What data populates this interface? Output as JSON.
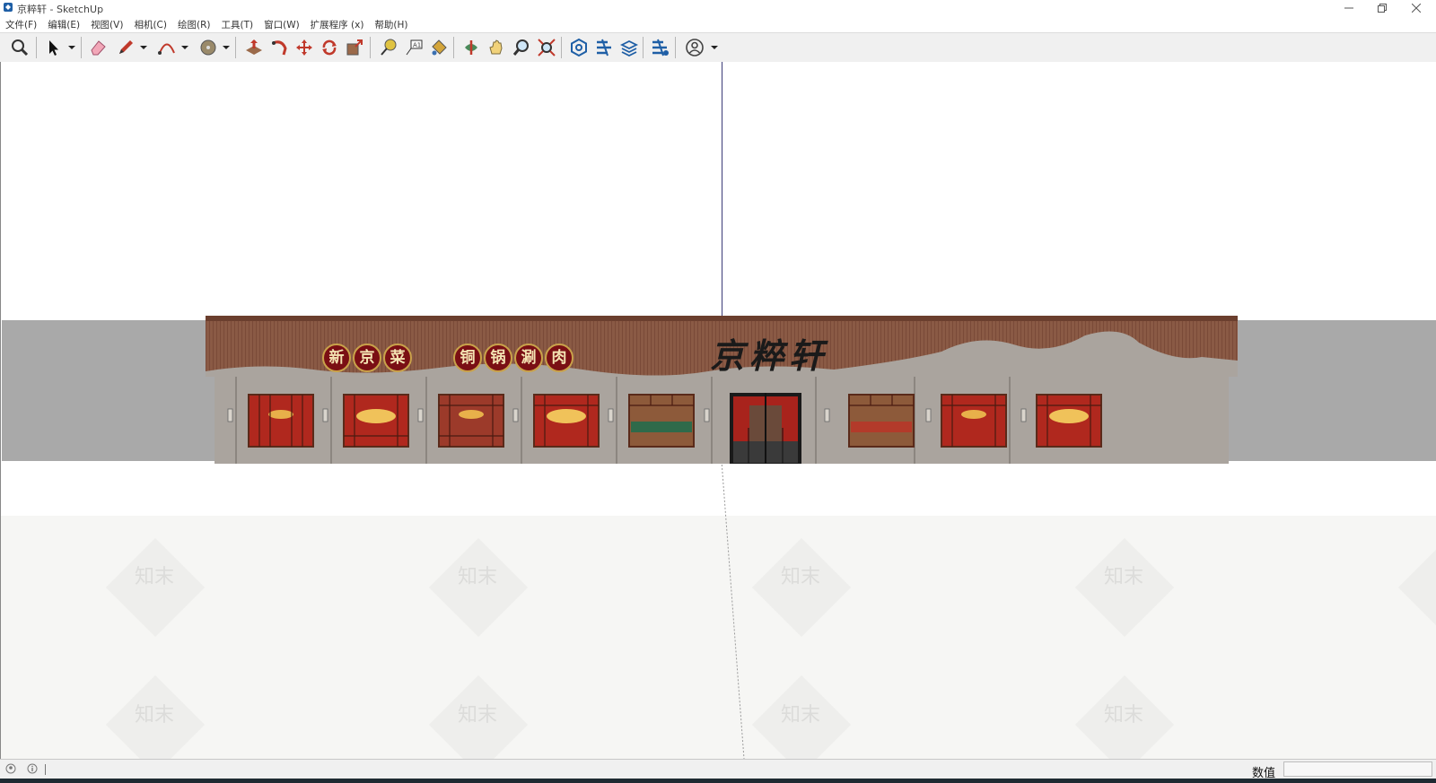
{
  "window": {
    "title": "京粹轩 - SketchUp",
    "app_icon": "sketchup-logo-icon"
  },
  "menu": [
    {
      "label": "文件(F)"
    },
    {
      "label": "编辑(E)"
    },
    {
      "label": "视图(V)"
    },
    {
      "label": "相机(C)"
    },
    {
      "label": "绘图(R)"
    },
    {
      "label": "工具(T)"
    },
    {
      "label": "窗口(W)"
    },
    {
      "label": "扩展程序 (x)"
    },
    {
      "label": "帮助(H)"
    }
  ],
  "toolbar": {
    "tools": [
      {
        "name": "search-icon"
      },
      {
        "name": "select-arrow-icon",
        "dropdown": true
      },
      {
        "name": "eraser-icon"
      },
      {
        "name": "pencil-line-icon",
        "dropdown": true
      },
      {
        "name": "arc-icon",
        "dropdown": true
      },
      {
        "name": "circle-shape-icon",
        "dropdown": true
      },
      {
        "name": "push-pull-icon"
      },
      {
        "name": "follow-me-icon"
      },
      {
        "name": "move-icon"
      },
      {
        "name": "rotate-icon"
      },
      {
        "name": "scale-icon"
      },
      {
        "name": "tape-measure-icon"
      },
      {
        "name": "text-label-icon"
      },
      {
        "name": "paint-bucket-icon"
      },
      {
        "name": "orbit-icon"
      },
      {
        "name": "pan-hand-icon"
      },
      {
        "name": "zoom-icon"
      },
      {
        "name": "zoom-extents-icon"
      },
      {
        "name": "3d-warehouse-icon"
      },
      {
        "name": "extension-manager-icon"
      },
      {
        "name": "layers-icon"
      },
      {
        "name": "extension-warehouse-icon"
      },
      {
        "name": "account-user-icon",
        "dropdown": true
      }
    ]
  },
  "model": {
    "sign_left": [
      "新",
      "京",
      "菜"
    ],
    "sign_right": [
      "铜",
      "锅",
      "涮",
      "肉"
    ],
    "brand_name": "京粹轩",
    "colors": {
      "roof_wood": "#8a5a45",
      "sign_red": "#7a0f14",
      "sign_gold": "#c9a24a",
      "wall_stone": "#a9a39d",
      "window_red": "#b0281e",
      "band_gray": "#a9a9a9"
    }
  },
  "watermark": {
    "text": "知末"
  },
  "statusbar": {
    "icons": [
      "geo-location-icon",
      "info-icon"
    ],
    "value_label": "数值",
    "value_input": ""
  }
}
